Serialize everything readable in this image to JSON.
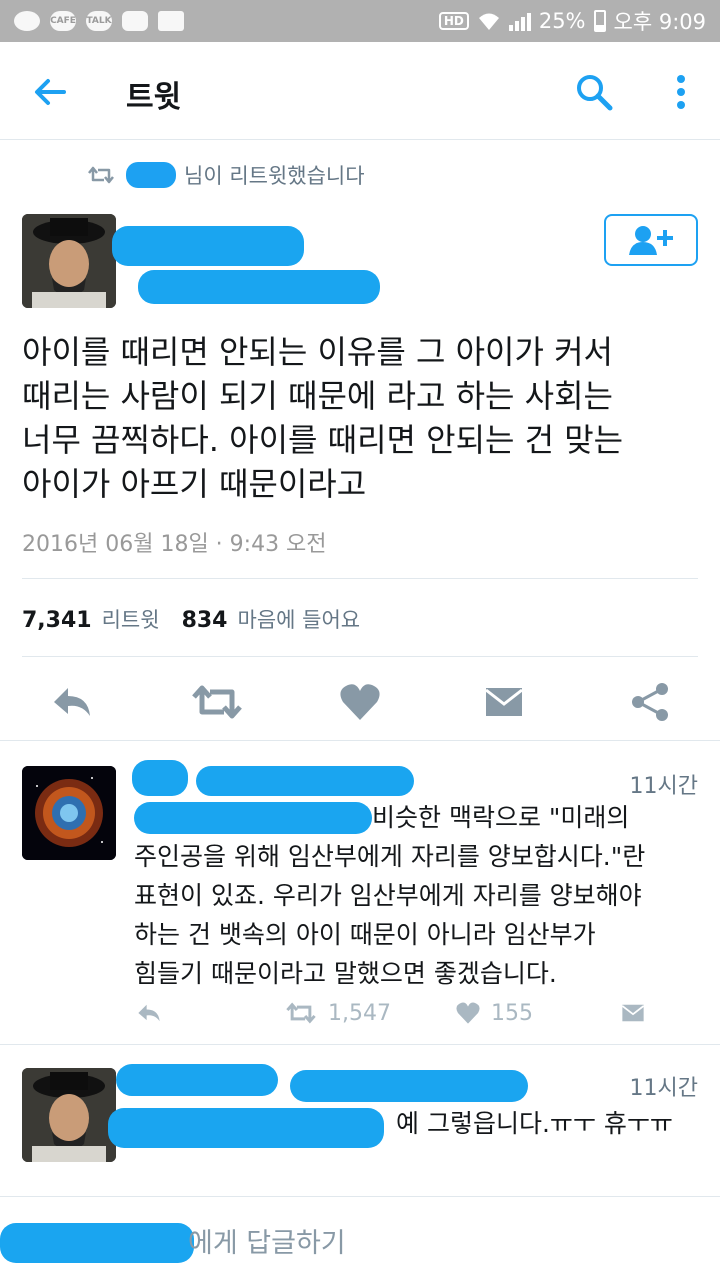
{
  "status_bar": {
    "battery": "25%",
    "time": "오후 9:09",
    "network": "HD"
  },
  "app_bar": {
    "title": "트윗"
  },
  "retweet_note": {
    "suffix": "님이 리트윗했습니다"
  },
  "tweet": {
    "lines": [
      "아이를 때리면 안되는 이유를 그 아이가 커서",
      "때리는 사람이 되기 때문에 라고 하는 사회는",
      "너무 끔찍하다. 아이를 때리면 안되는 건 맞는",
      "아이가 아프기 때문이라고"
    ],
    "timestamp": "2016년 06월 18일 · 9:43 오전",
    "retweets_count": "7,341",
    "retweets_label": "리트윗",
    "likes_count": "834",
    "likes_label": "마음에 들어요"
  },
  "replies": [
    {
      "time": "11시간",
      "lines": [
        "비슷한 맥락으로 \"미래의",
        "주인공을 위해 임산부에게 자리를 양보합시다.\"란",
        "표현이 있죠. 우리가 임산부에게 자리를 양보해야",
        "하는 건 뱃속의 아이 때문이 아니라 임산부가",
        "힘들기 때문이라고 말했으면 좋겠습니다."
      ],
      "retweets": "1,547",
      "likes": "155"
    },
    {
      "time": "11시간",
      "lines": [
        "예 그렇읍니다.ㅠㅜ 휴ㅜㅠ"
      ]
    }
  ],
  "composer": {
    "placeholder": "에게 답글하기"
  },
  "colors": {
    "accent": "#1da1f2",
    "muted": "#657786",
    "icon_gray": "#aab8c2"
  }
}
